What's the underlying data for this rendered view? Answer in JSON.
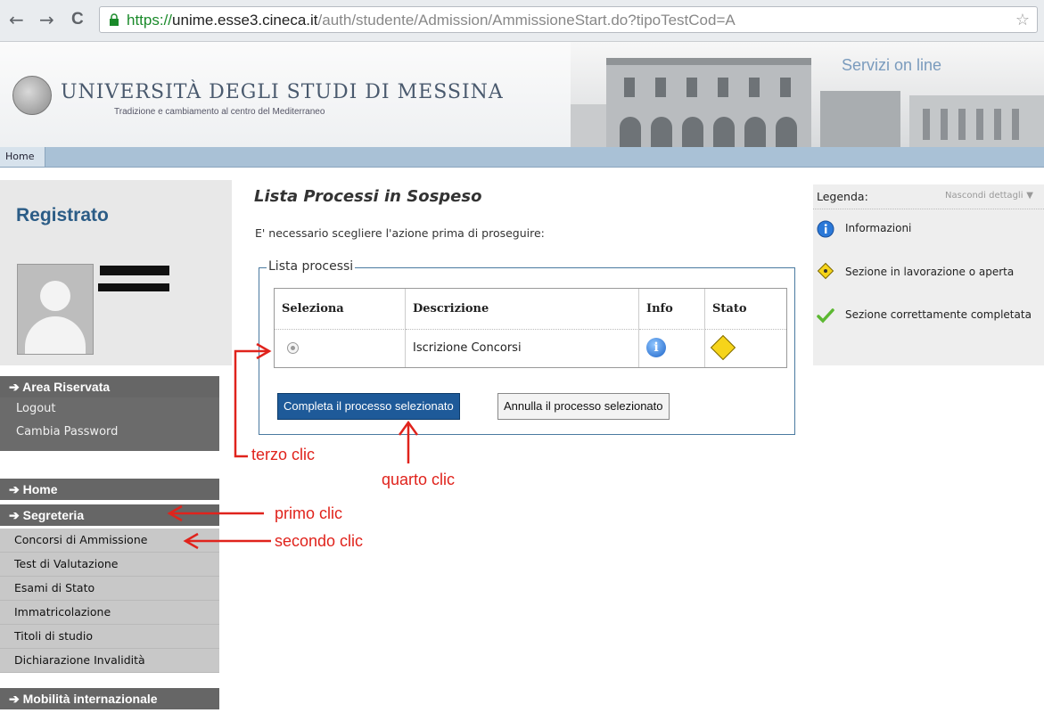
{
  "browser": {
    "back_glyph": "←",
    "forward_glyph": "→",
    "reload_glyph": "C",
    "url_scheme": "https://",
    "url_host": "unime.esse3.cineca.it",
    "url_path": "/auth/studente/Admission/AmmissioneStart.do?tipoTestCod=A",
    "bookmark_glyph": "☆"
  },
  "header": {
    "university": "UNIVERSITÀ DEGLI STUDI DI MESSINA",
    "tagline": "Tradizione e cambiamento al centro del Mediterraneo",
    "servizi": "Servizi on line"
  },
  "topnav": {
    "home": "Home"
  },
  "sidebar": {
    "status_title": "Registrato",
    "area_riservata": "Area Riservata",
    "area_items": [
      "Logout",
      "Cambia Password"
    ],
    "home": "Home",
    "segreteria": "Segreteria",
    "segreteria_items": [
      "Concorsi di Ammissione",
      "Test di Valutazione",
      "Esami di Stato",
      "Immatricolazione",
      "Titoli di studio",
      "Dichiarazione Invalidità"
    ],
    "mobilita": "Mobilità internazionale"
  },
  "main": {
    "title": "Lista Processi in Sospeso",
    "intro": "E' necessario scegliere l'azione prima di proseguire:",
    "fieldset_legend": "Lista processi",
    "columns": [
      "Seleziona",
      "Descrizione",
      "Info",
      "Stato"
    ],
    "row": {
      "descrizione": "Iscrizione Concorsi"
    },
    "btn_complete": "Completa il processo selezionato",
    "btn_cancel": "Annulla il processo selezionato"
  },
  "legend_panel": {
    "title": "Legenda:",
    "hide": "Nascondi dettagli",
    "items": [
      "Informazioni",
      "Sezione in lavorazione o aperta",
      "Sezione correttamente completata"
    ]
  },
  "annotations": {
    "terzo": "terzo clic",
    "quarto": "quarto clic",
    "primo": "primo clic",
    "secondo": "secondo clic"
  },
  "colors": {
    "accent_blue": "#1e5a99",
    "annotation_red": "#e0231c",
    "menu_dark": "#666666"
  }
}
